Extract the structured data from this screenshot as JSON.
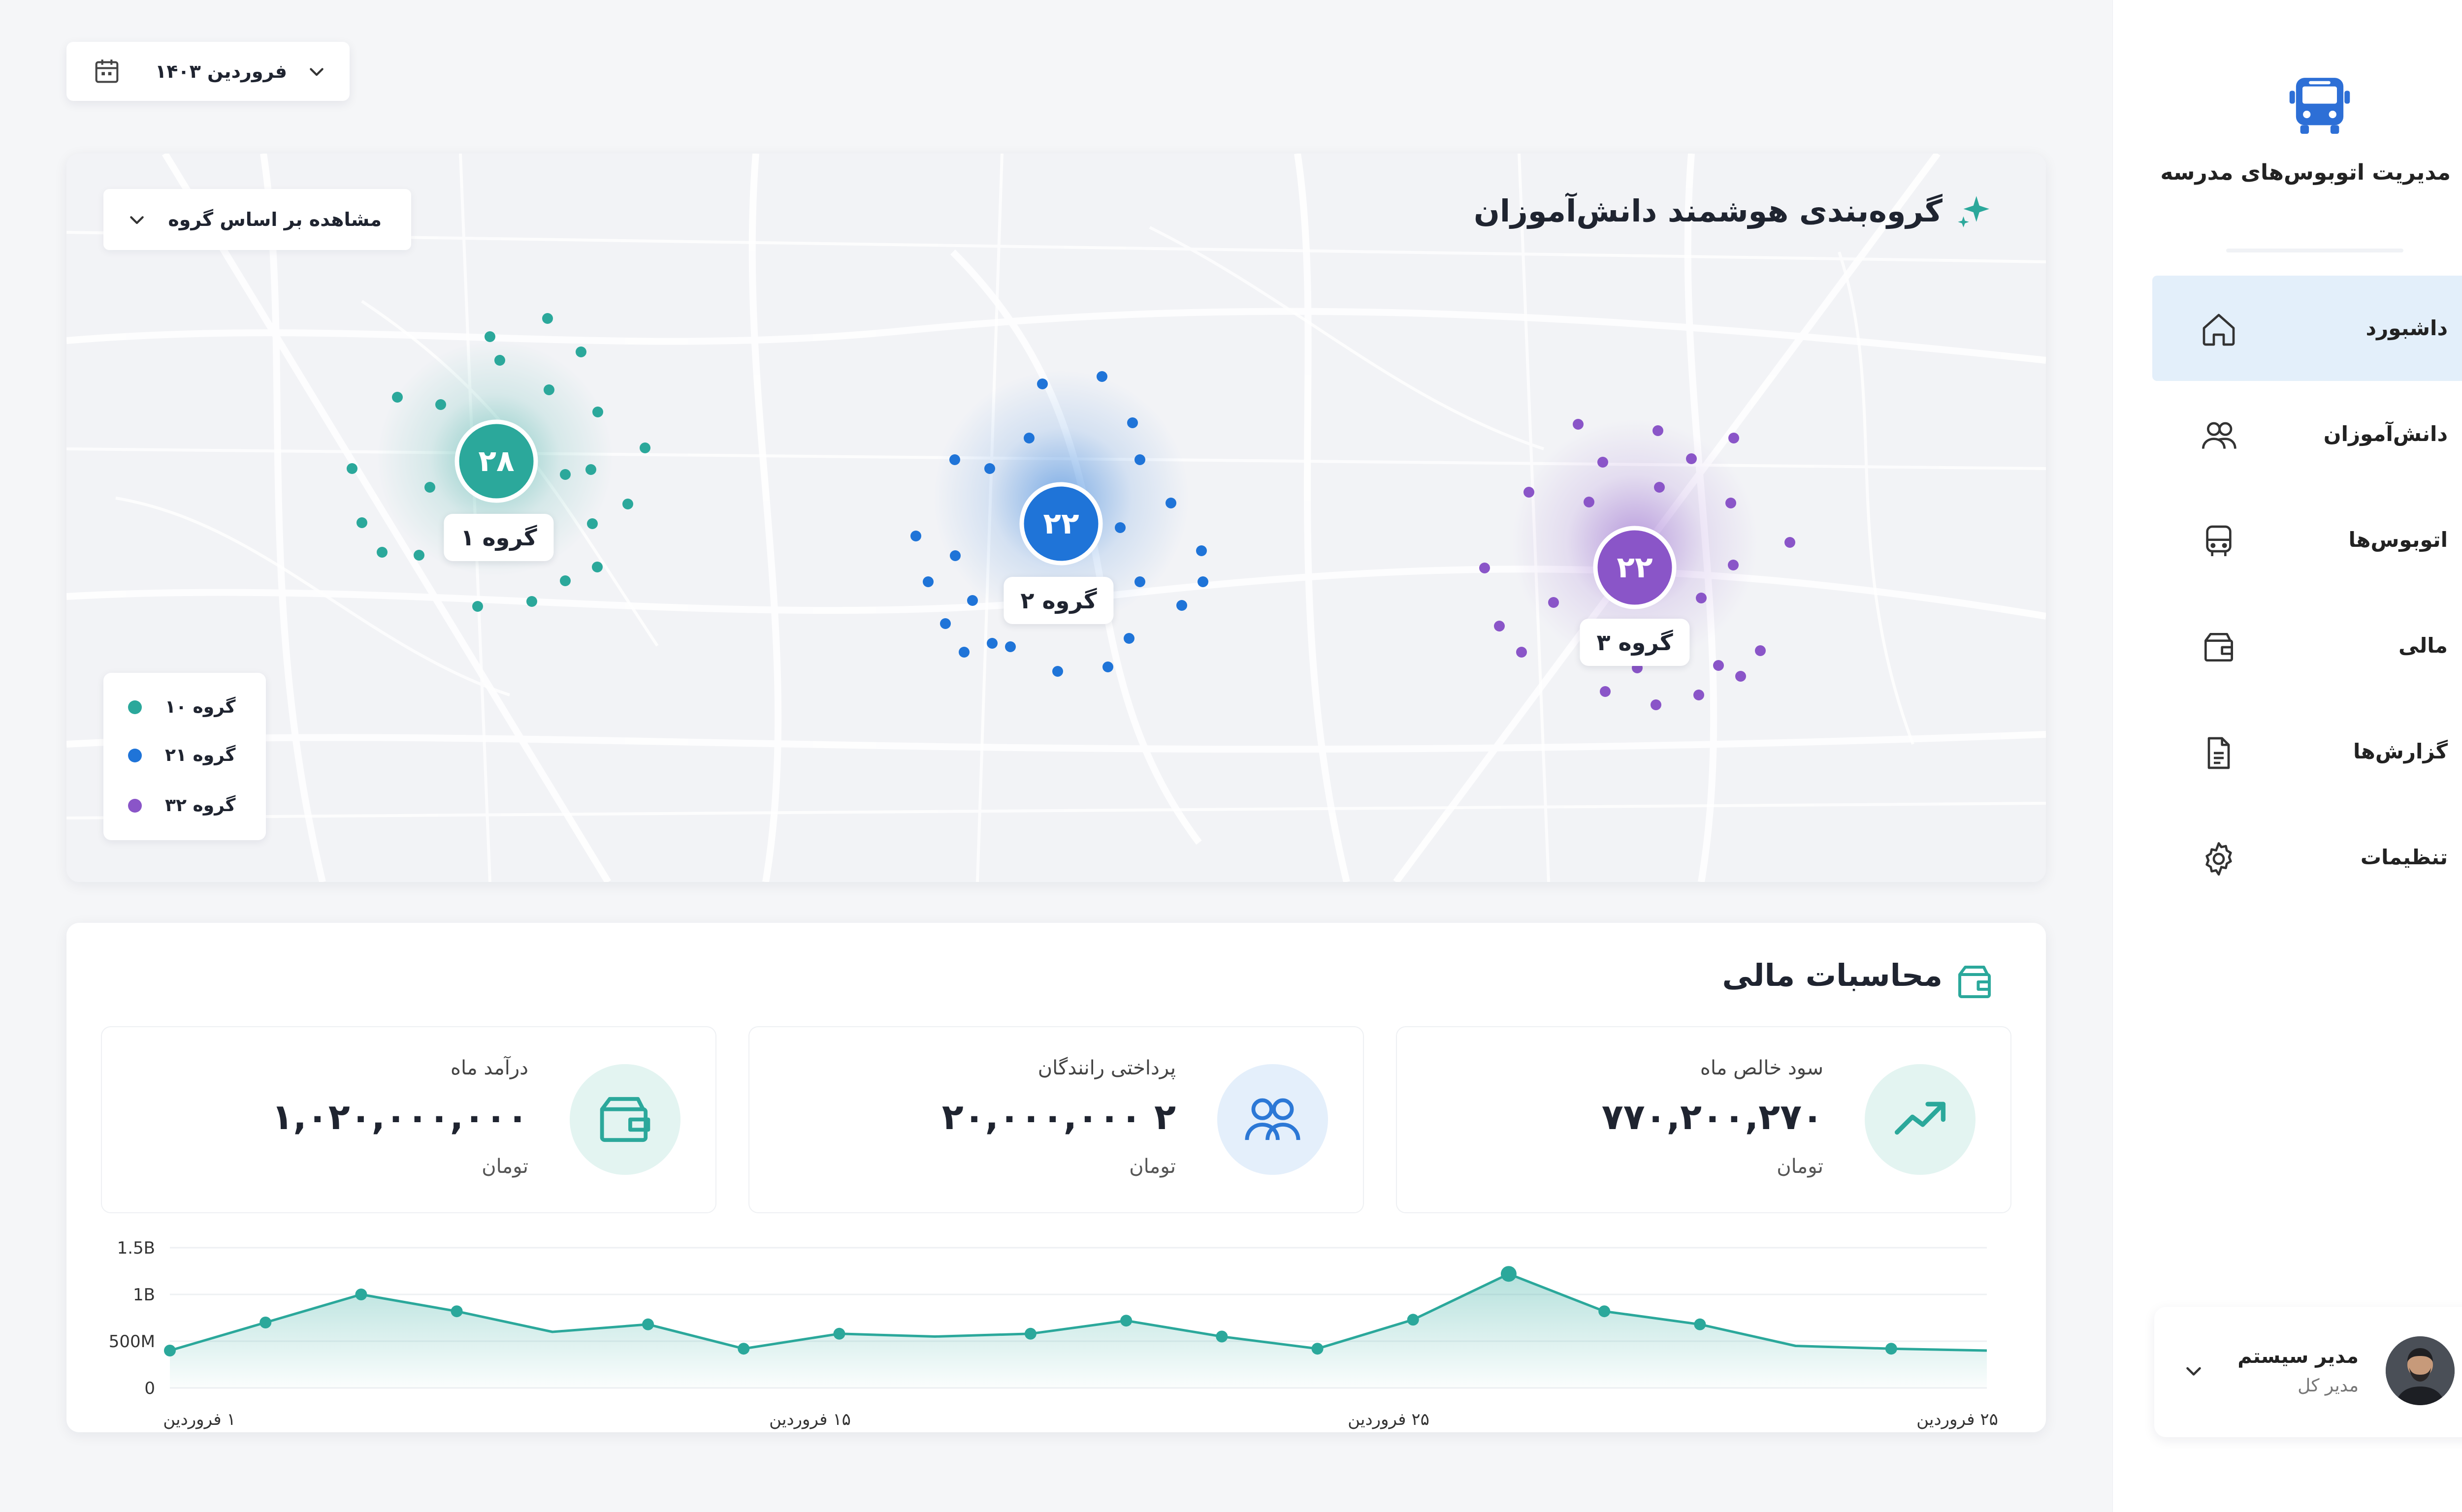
{
  "sidebar": {
    "brand_title": "مدیریت اتوبوس‌های مدرسه",
    "items": [
      {
        "label": "داشبورد",
        "icon": "home-icon",
        "active": true
      },
      {
        "label": "دانش‌آموزان",
        "icon": "users-icon",
        "active": false
      },
      {
        "label": "اتوبوس‌ها",
        "icon": "bus-icon",
        "active": false
      },
      {
        "label": "مالی",
        "icon": "wallet-icon",
        "active": false
      },
      {
        "label": "گزارش‌ها",
        "icon": "report-icon",
        "active": false
      },
      {
        "label": "تنظیمات",
        "icon": "gear-icon",
        "active": false
      }
    ]
  },
  "user": {
    "name": "مدیر سیستم",
    "role": "مدیر کل"
  },
  "date_picker": {
    "value": "فروردین ۱۴۰۳"
  },
  "grouping": {
    "title": "گروه‌بندی هوشمند دانش‌آموزان",
    "view_select": "مشاهده بر اساس گروه",
    "clusters": [
      {
        "label": "گروه ۱",
        "count": "۲۸",
        "color": "#2ba89b"
      },
      {
        "label": "گروه ۲",
        "count": "۲۲",
        "color": "#1f74d8"
      },
      {
        "label": "گروه ۳",
        "count": "۲۲",
        "color": "#8a55c8"
      }
    ],
    "legend": [
      {
        "label": "گروه ۱۰",
        "color": "#2ba89b"
      },
      {
        "label": "گروه ۲۱",
        "color": "#1f74d8"
      },
      {
        "label": "گروه ۳۲",
        "color": "#8a55c8"
      }
    ]
  },
  "finance": {
    "title": "محاسبات مالی",
    "stats": [
      {
        "label": "سود خالص ماه",
        "value": "۷۷۰,۲۰۰,۲۷۰",
        "unit": "تومان",
        "icon": "trend-up-icon",
        "bg": "#e3f4f1",
        "fg": "#2ba89b"
      },
      {
        "label": "پرداختی رانندگان",
        "value": "۲ ۲۰,۰۰۰,۰۰۰",
        "unit": "تومان",
        "icon": "users-icon",
        "bg": "#e4effb",
        "fg": "#2c78d6"
      },
      {
        "label": "درآمد ماه",
        "value": "۱,۰۲۰,۰۰۰,۰۰۰",
        "unit": "تومان",
        "icon": "wallet-icon",
        "bg": "#e3f4f1",
        "fg": "#2ba89b"
      }
    ]
  },
  "chart_data": {
    "type": "area",
    "y_tick_labels": [
      "0",
      "500M",
      "1B",
      "1.5B"
    ],
    "ylim": [
      0,
      1.5
    ],
    "x_tick_labels": [
      "۱ فروردین",
      "۱۵ فروردین",
      "۲۵ فروردین",
      "۲۵ فروردین"
    ],
    "x": [
      0,
      1,
      2,
      3,
      4,
      5,
      6,
      7,
      8,
      9,
      10,
      11,
      12,
      13,
      14,
      15,
      16,
      17,
      18,
      19
    ],
    "values": [
      0.4,
      0.7,
      1.0,
      0.82,
      0.6,
      0.68,
      0.42,
      0.58,
      0.55,
      0.58,
      0.72,
      0.55,
      0.42,
      0.73,
      1.22,
      0.82,
      0.68,
      0.45,
      0.42,
      0.4
    ],
    "marked_points": [
      0,
      1,
      2,
      3,
      5,
      6,
      7,
      9,
      10,
      11,
      12,
      13,
      14,
      15,
      16,
      18
    ],
    "color": "#2ba89b",
    "grid": true
  }
}
